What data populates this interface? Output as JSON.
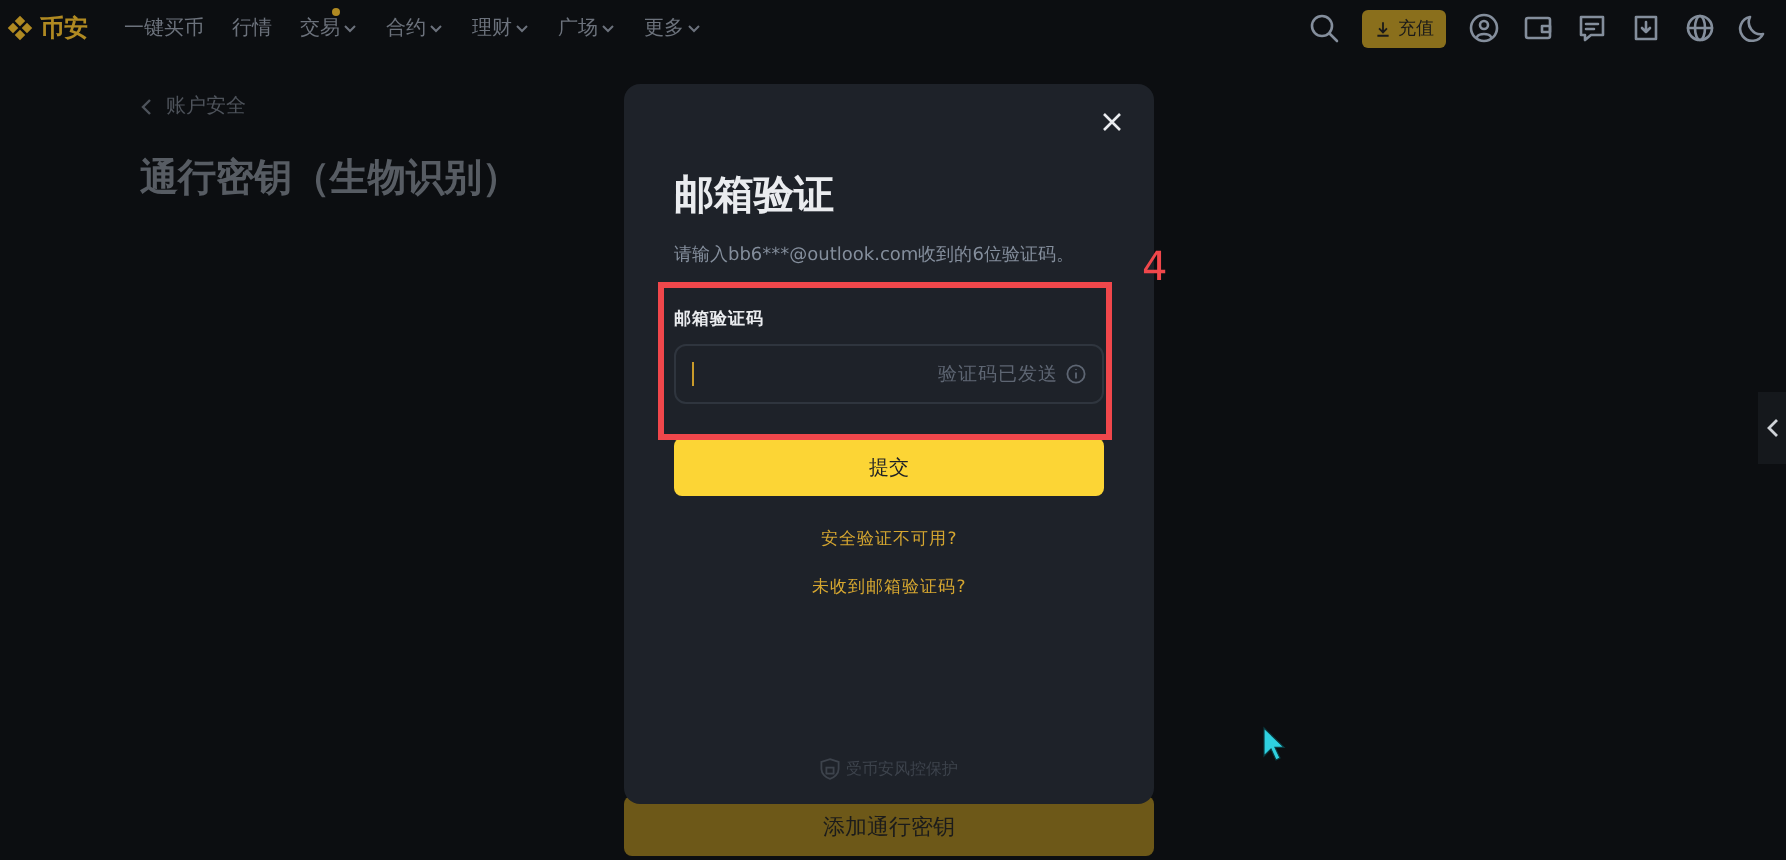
{
  "nav": {
    "logo": "币安",
    "items": [
      {
        "label": "一键买币",
        "dropdown": false,
        "dot": false
      },
      {
        "label": "行情",
        "dropdown": false,
        "dot": false
      },
      {
        "label": "交易",
        "dropdown": true,
        "dot": true
      },
      {
        "label": "合约",
        "dropdown": true,
        "dot": false
      },
      {
        "label": "理财",
        "dropdown": true,
        "dot": false
      },
      {
        "label": "广场",
        "dropdown": true,
        "dot": false
      },
      {
        "label": "更多",
        "dropdown": true,
        "dot": false
      }
    ],
    "deposit_button": "充值"
  },
  "page": {
    "breadcrumb": "账户安全",
    "title": "通行密钥（生物识别）",
    "add_button": "添加通行密钥"
  },
  "modal": {
    "title": "邮箱验证",
    "description": "请输入bb6***@outlook.com收到的6位验证码。",
    "field_label": "邮箱验证码",
    "field_status": "验证码已发送",
    "submit": "提交",
    "links": [
      "安全验证不可用?",
      "未收到邮箱验证码?"
    ],
    "footer": "受币安风控保护"
  },
  "annotation": {
    "label": "4"
  }
}
